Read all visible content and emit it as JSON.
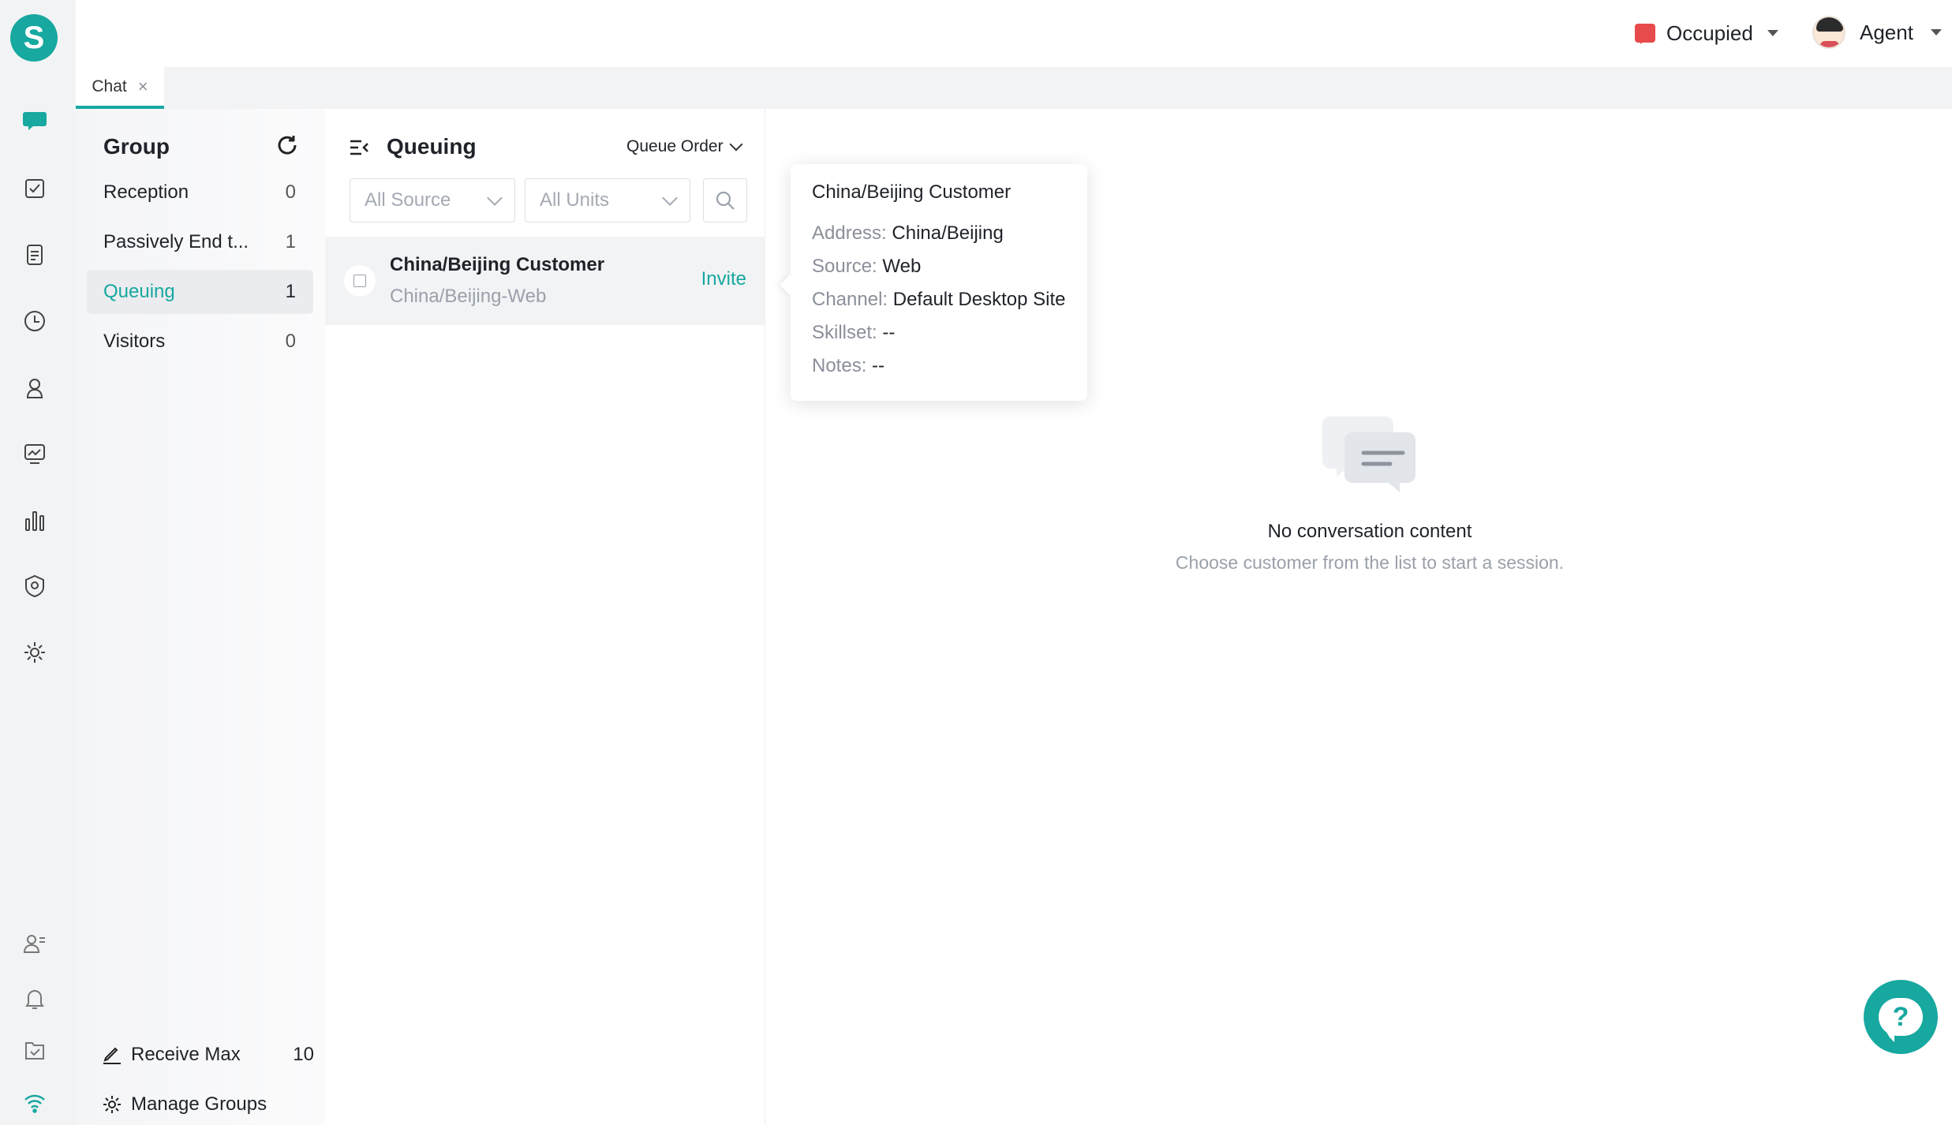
{
  "app": {
    "logo_letter": "S",
    "accent_color": "#17a8a0"
  },
  "rail": {
    "icons": [
      "chat-icon",
      "task-icon",
      "ticket-icon",
      "history-icon",
      "customer-icon",
      "monitor-icon",
      "report-icon",
      "security-icon",
      "settings-icon"
    ],
    "bottom_icons": [
      "contact-icon",
      "bell-icon",
      "inbox-icon",
      "wifi-icon"
    ]
  },
  "header": {
    "status_label": "Occupied",
    "status_color": "#e84b4b",
    "agent_label": "Agent"
  },
  "tabs": [
    {
      "label": "Chat",
      "close": "×"
    }
  ],
  "groups": {
    "title": "Group",
    "items": [
      {
        "label": "Reception",
        "count": "0"
      },
      {
        "label": "Passively End t...",
        "count": "1"
      },
      {
        "label": "Queuing",
        "count": "1"
      },
      {
        "label": "Visitors",
        "count": "0"
      }
    ],
    "receive_max_label": "Receive Max",
    "receive_max_value": "10",
    "manage_label": "Manage Groups"
  },
  "queue": {
    "title": "Queuing",
    "order_label": "Queue Order",
    "source_placeholder": "All Source",
    "units_placeholder": "All Units",
    "rows": [
      {
        "name": "China/Beijing Customer",
        "sub": "China/Beijing-Web",
        "action": "Invite"
      }
    ]
  },
  "tooltip": {
    "title": "China/Beijing Customer",
    "address_key": "Address:",
    "address_val": "China/Beijing",
    "source_key": "Source:",
    "source_val": "Web",
    "channel_key": "Channel:",
    "channel_val": "Default Desktop Site",
    "skillset_key": "Skillset:",
    "skillset_val": "--",
    "notes_key": "Notes:",
    "notes_val": "--"
  },
  "empty": {
    "title": "No conversation content",
    "subtitle": "Choose customer from the list to start a session."
  },
  "help": {
    "glyph": "?"
  }
}
